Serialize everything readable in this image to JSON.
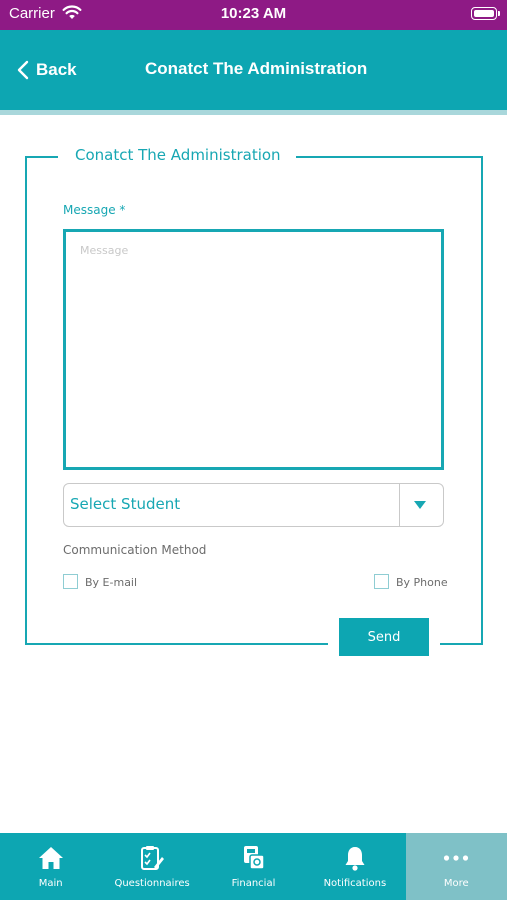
{
  "status_bar": {
    "carrier": "Carrier",
    "time": "10:23 AM"
  },
  "nav": {
    "back_label": "Back",
    "title": "Conatct The Administration"
  },
  "form": {
    "legend": "Conatct The Administration",
    "message_label": "Message *",
    "message_placeholder": "Message",
    "message_value": "",
    "student_select_value": "Select Student",
    "communication_label": "Communication Method",
    "option_email": "By E-mail",
    "option_phone": "By Phone",
    "email_checked": false,
    "phone_checked": false,
    "send_label": "Send"
  },
  "tabs": [
    {
      "label": "Main",
      "icon": "home-icon",
      "active": false
    },
    {
      "label": "Questionnaires",
      "icon": "questionnaire-icon",
      "active": false
    },
    {
      "label": "Financial",
      "icon": "financial-icon",
      "active": false
    },
    {
      "label": "Notifications",
      "icon": "bell-icon",
      "active": false
    },
    {
      "label": "More",
      "icon": "more-icon",
      "active": true
    }
  ],
  "colors": {
    "accent": "#0da6b2",
    "status_bar": "#8e1a85",
    "active_tab": "#7fc1c7"
  }
}
